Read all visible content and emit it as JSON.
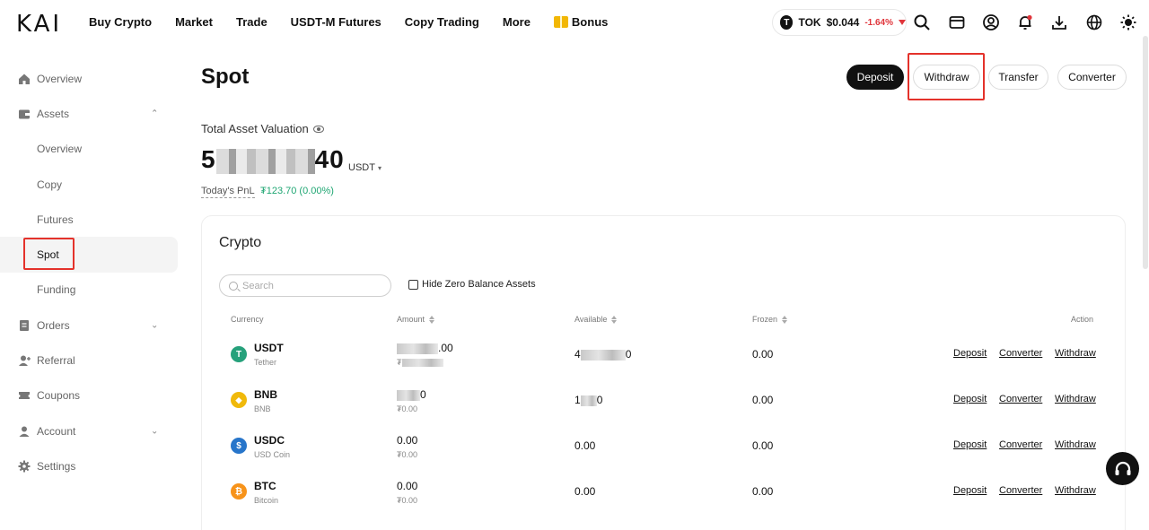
{
  "brand": {
    "logo_text": "KAI"
  },
  "nav": {
    "items": [
      "Buy Crypto",
      "Market",
      "Trade",
      "USDT-M Futures",
      "Copy Trading",
      "More"
    ],
    "bonus": "Bonus"
  },
  "ticker": {
    "symbol": "TOK",
    "price": "$0.044",
    "change": "-1.64%",
    "change_color": "#e0353b"
  },
  "toolbar_icons": [
    "search-icon",
    "wallet-icon",
    "user-icon",
    "bell-icon",
    "download-icon",
    "globe-icon",
    "theme-icon"
  ],
  "sidebar": {
    "items": [
      {
        "label": "Overview"
      },
      {
        "label": "Assets"
      },
      {
        "label": "Overview"
      },
      {
        "label": "Copy"
      },
      {
        "label": "Futures"
      },
      {
        "label": "Spot"
      },
      {
        "label": "Funding"
      },
      {
        "label": "Orders"
      },
      {
        "label": "Referral"
      },
      {
        "label": "Coupons"
      },
      {
        "label": "Account"
      },
      {
        "label": "Settings"
      }
    ]
  },
  "page": {
    "title": "Spot",
    "buttons": {
      "deposit": "Deposit",
      "withdraw": "Withdraw",
      "transfer": "Transfer",
      "converter": "Converter"
    },
    "valuation_label": "Total Asset Valuation",
    "balance_prefix": "5",
    "balance_suffix": "40",
    "unit": "USDT",
    "pnl_label": "Today's PnL",
    "pnl_value": "₮123.70 (0.00%)",
    "accent_green": "#1ea672"
  },
  "crypto": {
    "title": "Crypto",
    "search_placeholder": "Search",
    "hide_zero_label": "Hide Zero Balance Assets",
    "columns": {
      "currency": "Currency",
      "amount": "Amount",
      "available": "Available",
      "frozen": "Frozen",
      "action": "Action"
    },
    "rows": [
      {
        "symbol": "USDT",
        "name": "Tether",
        "amount": ".00",
        "amount_sub": "₮",
        "available": "4",
        "available_tail": "0",
        "frozen": "0.00",
        "icon_color": "#26a17b",
        "icon_glyph": "T"
      },
      {
        "symbol": "BNB",
        "name": "BNB",
        "amount": "0",
        "amount_sub": "₮0.00",
        "available": "1",
        "available_tail": "0",
        "frozen": "0.00",
        "icon_color": "#f0b90b",
        "icon_glyph": "◆"
      },
      {
        "symbol": "USDC",
        "name": "USD Coin",
        "amount": "0.00",
        "amount_sub": "₮0.00",
        "available": "0.00",
        "available_tail": "",
        "frozen": "0.00",
        "icon_color": "#2775ca",
        "icon_glyph": "$"
      },
      {
        "symbol": "BTC",
        "name": "Bitcoin",
        "amount": "0.00",
        "amount_sub": "₮0.00",
        "available": "0.00",
        "available_tail": "",
        "frozen": "0.00",
        "icon_color": "#f7931a",
        "icon_glyph": "₿"
      }
    ],
    "actions": {
      "deposit": "Deposit",
      "converter": "Converter",
      "withdraw": "Withdraw"
    }
  }
}
